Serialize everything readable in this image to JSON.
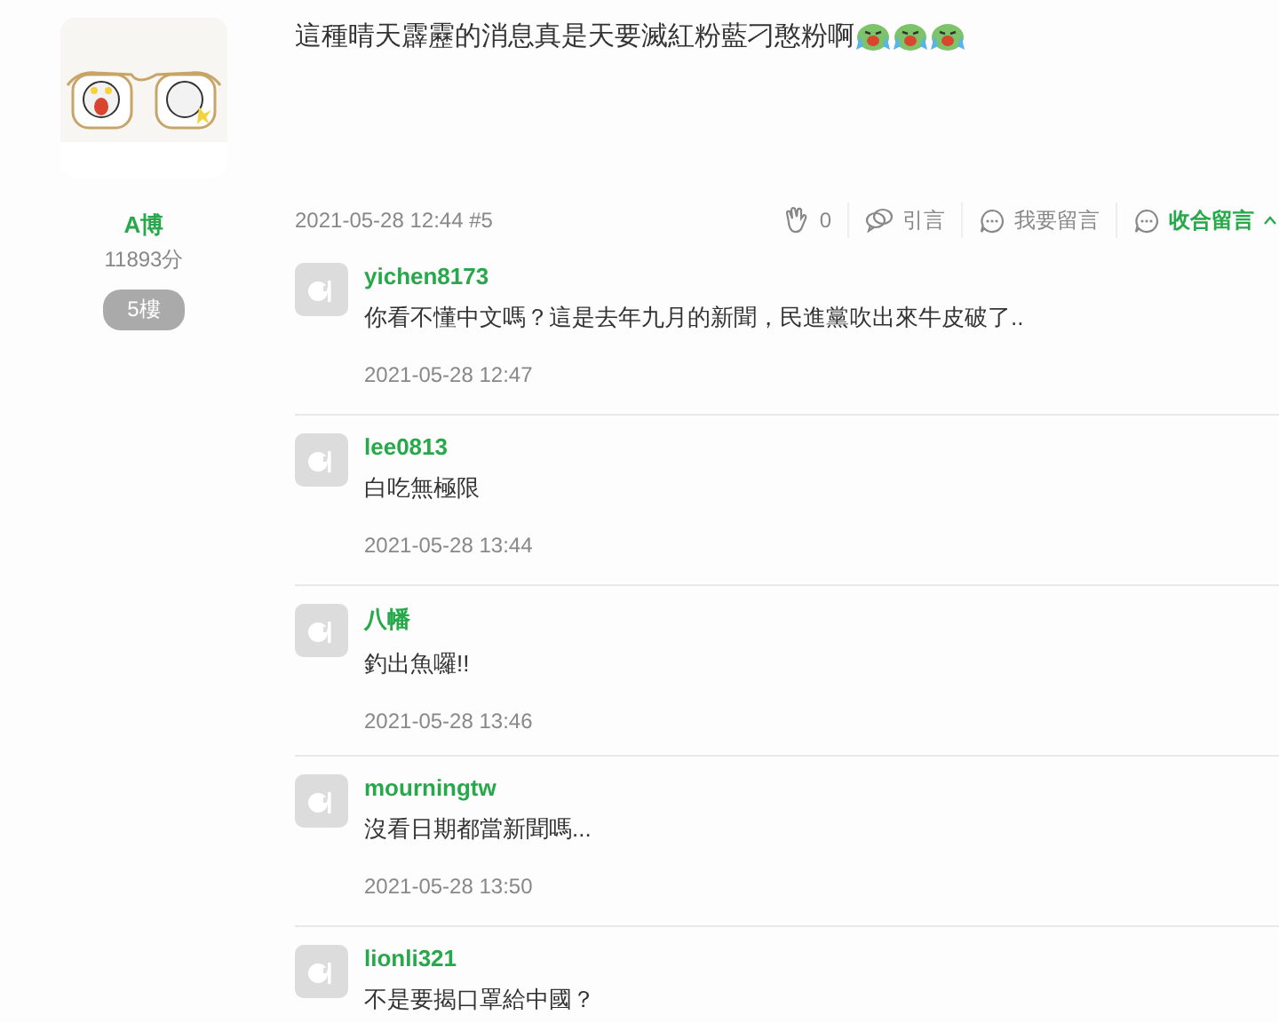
{
  "author": {
    "name": "A博",
    "points": "11893分",
    "floor": "5樓"
  },
  "post": {
    "text": "這種晴天霹靂的消息真是天要滅紅粉藍刁憨粉啊",
    "meta": "2021-05-28 12:44 #5",
    "actions": [
      {
        "kind": "clap",
        "label": "0"
      },
      {
        "kind": "quote",
        "label": "引言"
      },
      {
        "kind": "reply",
        "label": "我要留言"
      },
      {
        "kind": "collapse",
        "label": "收合留言"
      }
    ]
  },
  "comments": [
    {
      "user": "yichen8173",
      "text": "你看不懂中文嗎？這是去年九月的新聞，民進黨吹出來牛皮破了..",
      "time": "2021-05-28 12:47"
    },
    {
      "user": "lee0813",
      "text": "白吃無極限",
      "time": "2021-05-28 13:44"
    },
    {
      "user": "八幡",
      "text": "釣出魚囉!!",
      "time": "2021-05-28 13:46"
    },
    {
      "user": "mourningtw",
      "text": "沒看日期都當新聞嗎...",
      "time": "2021-05-28 13:50"
    },
    {
      "user": "lionli321",
      "text": "不是要揭口罩給中國？"
    }
  ]
}
